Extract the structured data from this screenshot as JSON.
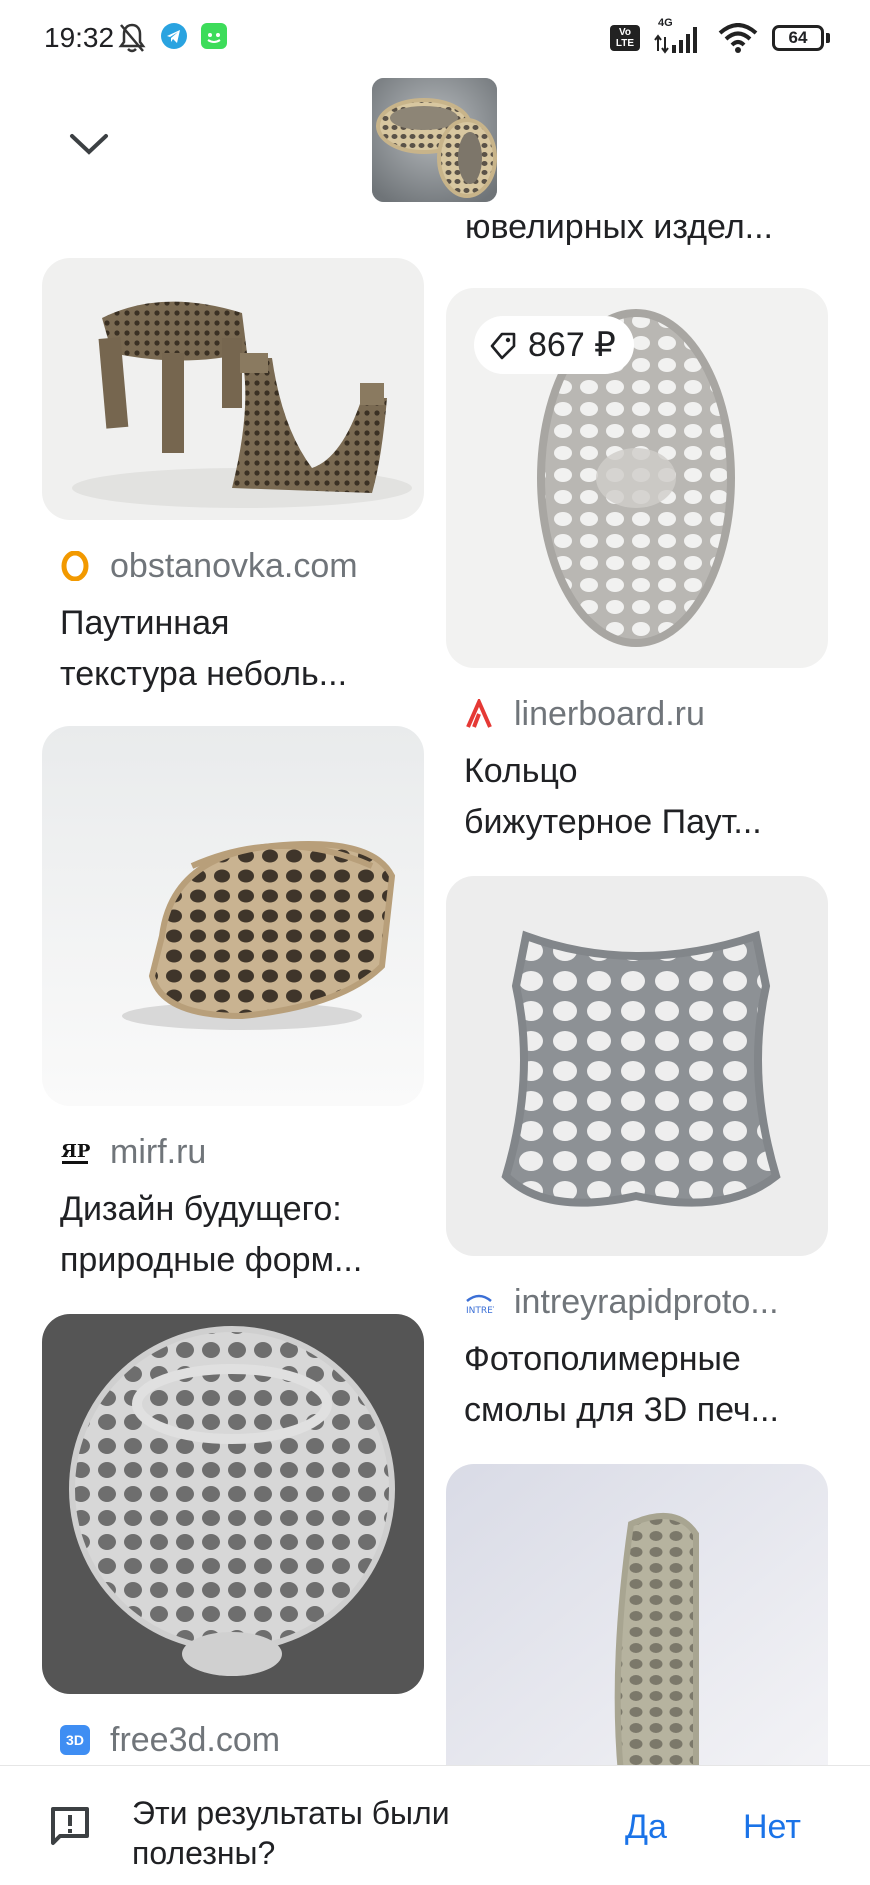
{
  "status_bar": {
    "time": "19:32",
    "network": "4G",
    "volte": "Vo LTE",
    "battery": "64",
    "icons": [
      "mute-bell-icon",
      "telegram-icon",
      "android-app-icon",
      "volte-icon",
      "signal-icon",
      "wifi-icon",
      "battery-icon"
    ]
  },
  "header": {
    "collapse_icon": "chevron-down-icon",
    "truncated_title": "ювелирных издел..."
  },
  "results": [
    {
      "source": "obstanovka.com",
      "title_lines": [
        "Паутинная",
        "текстура неболь..."
      ],
      "favicon": "orange-ring-icon"
    },
    {
      "source": "linerboard.ru",
      "title_lines": [
        "Кольцо",
        "бижутерное Паут..."
      ],
      "favicon": "red-lambda-icon",
      "price": "867 ₽"
    },
    {
      "source": "mirf.ru",
      "title_lines": [
        "Дизайн будущего:",
        "природные форм..."
      ],
      "favicon": "mirf-logo-icon"
    },
    {
      "source": "intreyrapidproto...",
      "title_lines": [
        "Фотополимерные",
        "смолы для 3D печ..."
      ],
      "favicon": "intrey-logo-icon"
    },
    {
      "source": "free3d.com",
      "favicon": "free3d-icon",
      "favicon_text": "3D"
    }
  ],
  "feedback": {
    "question": "Эти результаты были полезны?",
    "yes": "Да",
    "no": "Нет",
    "icon": "feedback-icon"
  }
}
